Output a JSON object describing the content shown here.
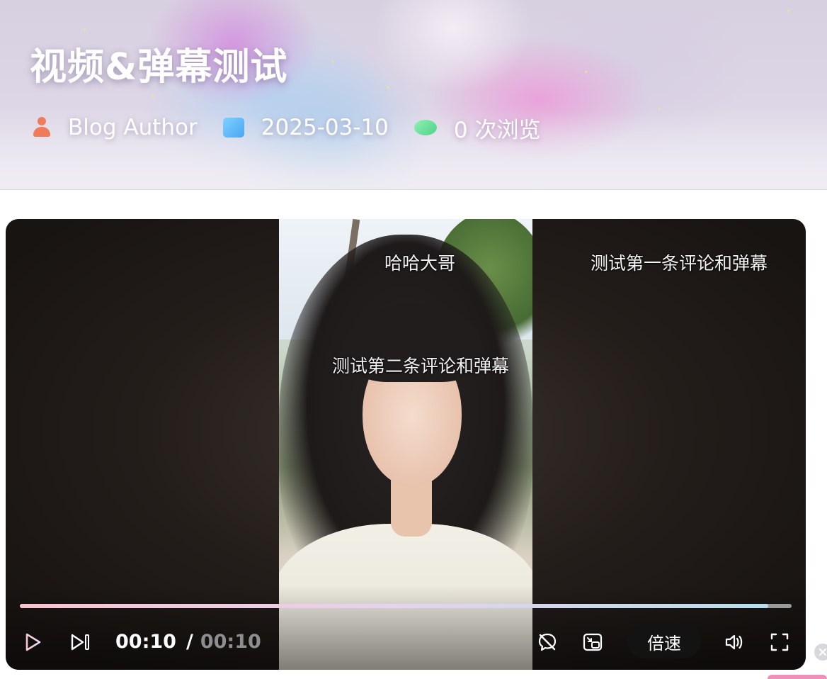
{
  "post": {
    "title": "视频&弹幕测试",
    "author": "Blog Author",
    "date": "2025-03-10",
    "views": "0 次浏览"
  },
  "icons": {
    "author": "user-icon",
    "date": "calendar-icon",
    "views": "eye-icon"
  },
  "colors": {
    "author_icon": "#f07b5a",
    "calendar_icon": "#4aa6f3",
    "eye_icon": "#4fd28a",
    "progress_start": "#f6c3cf",
    "progress_end": "#b9dcea"
  },
  "player": {
    "danmaku": [
      {
        "text": "哈哈大哥"
      },
      {
        "text": "测试第一条评论和弹幕"
      },
      {
        "text": "测试第二条评论和弹幕"
      }
    ],
    "current_time": "00:10",
    "separator": "/",
    "duration": "00:10",
    "speed_label": "倍速",
    "progress": 0.97
  }
}
